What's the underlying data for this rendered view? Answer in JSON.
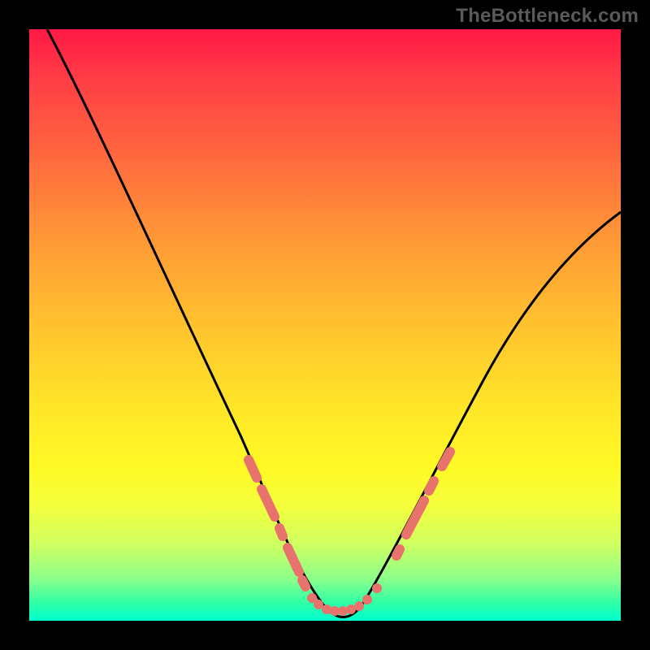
{
  "watermark": "TheBottleneck.com",
  "chart_data": {
    "type": "line",
    "title": "",
    "xlabel": "",
    "ylabel": "",
    "xlim": [
      0,
      100
    ],
    "ylim": [
      0,
      100
    ],
    "series": [
      {
        "name": "curve",
        "x": [
          3,
          10,
          20,
          30,
          40,
          45,
          48,
          50,
          52,
          55,
          58,
          62,
          70,
          80,
          90,
          100
        ],
        "y": [
          100,
          83,
          62,
          42,
          22,
          12,
          5,
          2,
          1,
          2,
          5,
          12,
          26,
          42,
          55,
          67
        ]
      }
    ],
    "markers": [
      {
        "x": 38,
        "y": 24
      },
      {
        "x": 40,
        "y": 20
      },
      {
        "x": 42,
        "y": 16
      },
      {
        "x": 44,
        "y": 12
      },
      {
        "x": 46,
        "y": 7
      },
      {
        "x": 47,
        "y": 4
      },
      {
        "x": 49,
        "y": 2
      },
      {
        "x": 50,
        "y": 1.5
      },
      {
        "x": 52,
        "y": 1.5
      },
      {
        "x": 54,
        "y": 2
      },
      {
        "x": 55,
        "y": 2.5
      },
      {
        "x": 57,
        "y": 3.5
      },
      {
        "x": 59,
        "y": 6
      },
      {
        "x": 63,
        "y": 12
      },
      {
        "x": 65,
        "y": 16
      },
      {
        "x": 66,
        "y": 18
      },
      {
        "x": 68,
        "y": 22
      },
      {
        "x": 70,
        "y": 26
      }
    ]
  }
}
